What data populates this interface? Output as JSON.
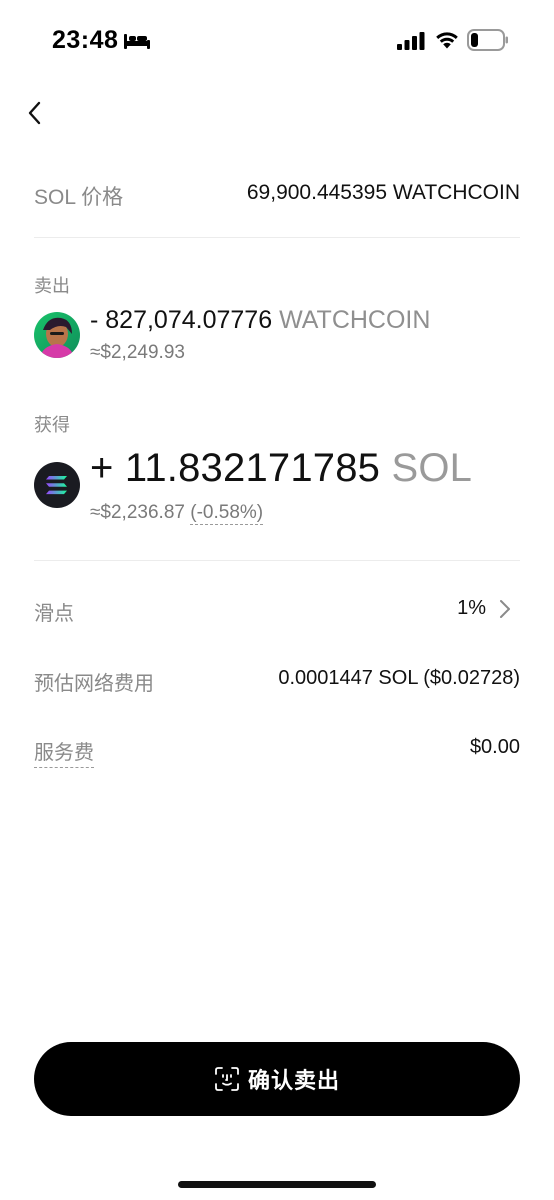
{
  "status_bar": {
    "time": "23:48",
    "icons": [
      "bed-icon",
      "signal-icon",
      "wifi-icon",
      "battery-icon"
    ]
  },
  "nav": {
    "back_icon": "chevron-left-icon"
  },
  "price_row": {
    "label": "SOL 价格",
    "value": "69,900.445395 WATCHCOIN"
  },
  "sell": {
    "label": "卖出",
    "token_icon": "watchcoin-avatar",
    "amount": "- 827,074.07776",
    "unit": "WATCHCOIN",
    "usd": "≈$2,249.93"
  },
  "receive": {
    "label": "获得",
    "token_icon": "solana-logo",
    "amount": "+ 11.832171785",
    "unit": "SOL",
    "usd": "≈$2,236.87",
    "change": "(-0.58%)"
  },
  "details": {
    "slippage_label": "滑点",
    "slippage_value": "1%",
    "network_fee_label": "预估网络费用",
    "network_fee_value": "0.0001447 SOL ($0.02728)",
    "service_fee_label": "服务费",
    "service_fee_value": "$0.00"
  },
  "confirm": {
    "icon": "face-id-icon",
    "label": "确认卖出"
  },
  "colors": {
    "primary_button": "#000000",
    "muted_text": "#8a8a8a",
    "solana_bg": "#1a1b21"
  }
}
